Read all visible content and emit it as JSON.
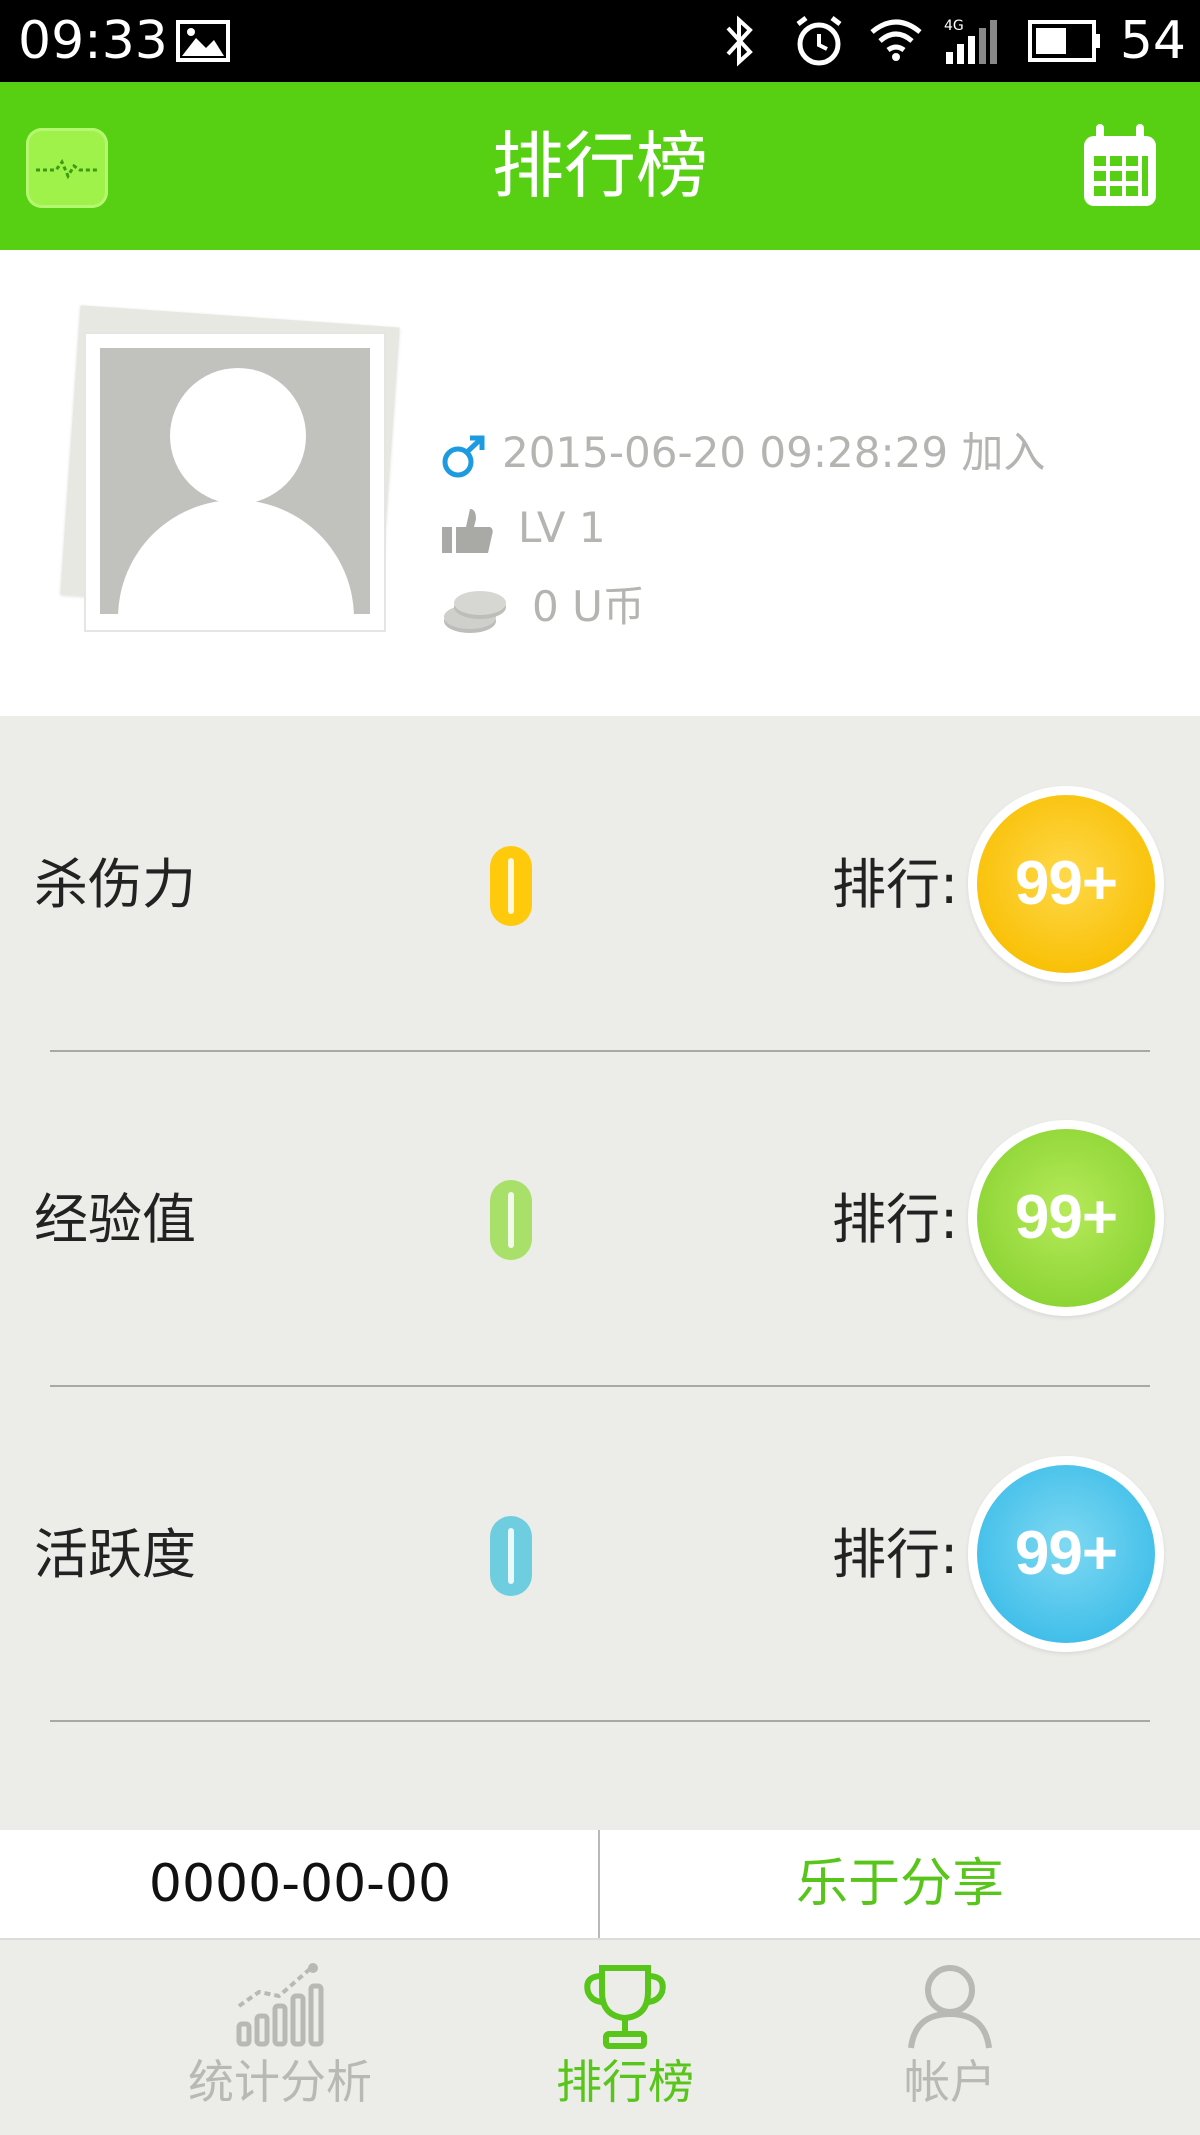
{
  "status_bar": {
    "time": "09:33",
    "battery": "54"
  },
  "header": {
    "title": "排行榜"
  },
  "profile": {
    "joined": "2015-06-20 09:28:29 加入",
    "level": "LV 1",
    "coins": "0 U币"
  },
  "stats": [
    {
      "label": "杀伤力",
      "value_label": "0",
      "rank_label": "排行:",
      "rank": "99+",
      "color": "#ffc90c"
    },
    {
      "label": "经验值",
      "value_label": "0",
      "rank_label": "排行:",
      "rank": "99+",
      "color": "#96df36"
    },
    {
      "label": "活跃度",
      "value_label": "0",
      "rank_label": "排行:",
      "rank": "99+",
      "color": "#3fc0e8"
    }
  ],
  "action_bar": {
    "date": "0000-00-00",
    "share": "乐于分享"
  },
  "tabs": [
    {
      "label": "统计分析",
      "active": false
    },
    {
      "label": "排行榜",
      "active": true
    },
    {
      "label": "帐户",
      "active": false
    }
  ],
  "colors": {
    "primary": "#57d013",
    "accent_text": "#57c51a",
    "inactive_tab": "#b8b8b4"
  }
}
